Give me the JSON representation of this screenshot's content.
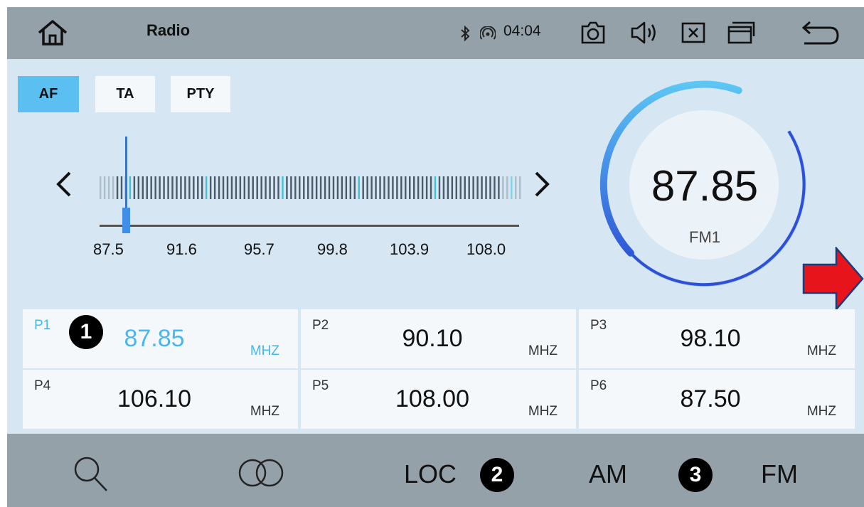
{
  "statusbar": {
    "title": "Radio",
    "time": "04:04",
    "icons": [
      "home-icon",
      "bluetooth-icon",
      "signal-icon",
      "camera-icon",
      "volume-icon",
      "close-icon",
      "window-icon",
      "back-icon"
    ]
  },
  "toggles": [
    {
      "label": "AF",
      "active": true
    },
    {
      "label": "TA",
      "active": false
    },
    {
      "label": "PTY",
      "active": false
    }
  ],
  "tuner": {
    "scale_labels": [
      "87.5",
      "91.6",
      "95.7",
      "99.8",
      "103.9",
      "108.0"
    ],
    "position_fraction": 0.0,
    "range": [
      87.5,
      108.0
    ]
  },
  "dial": {
    "frequency": "87.85",
    "band": "FM1"
  },
  "presets": [
    {
      "label": "P1",
      "frequency": "87.85",
      "unit": "MHZ",
      "active": true
    },
    {
      "label": "P2",
      "frequency": "90.10",
      "unit": "MHZ",
      "active": false
    },
    {
      "label": "P3",
      "frequency": "98.10",
      "unit": "MHZ",
      "active": false
    },
    {
      "label": "P4",
      "frequency": "106.10",
      "unit": "MHZ",
      "active": false
    },
    {
      "label": "P5",
      "frequency": "108.00",
      "unit": "MHZ",
      "active": false
    },
    {
      "label": "P6",
      "frequency": "87.50",
      "unit": "MHZ",
      "active": false
    }
  ],
  "bottombar": {
    "loc_label": "LOC",
    "am_label": "AM",
    "fm_label": "FM"
  },
  "annotations": {
    "badge1": "1",
    "badge2": "2",
    "badge3": "3"
  },
  "colors": {
    "accent": "#5cbff2",
    "bar": "#95a1a9",
    "background": "#d6e7f3",
    "pointer_arrow": "#e8141c"
  }
}
